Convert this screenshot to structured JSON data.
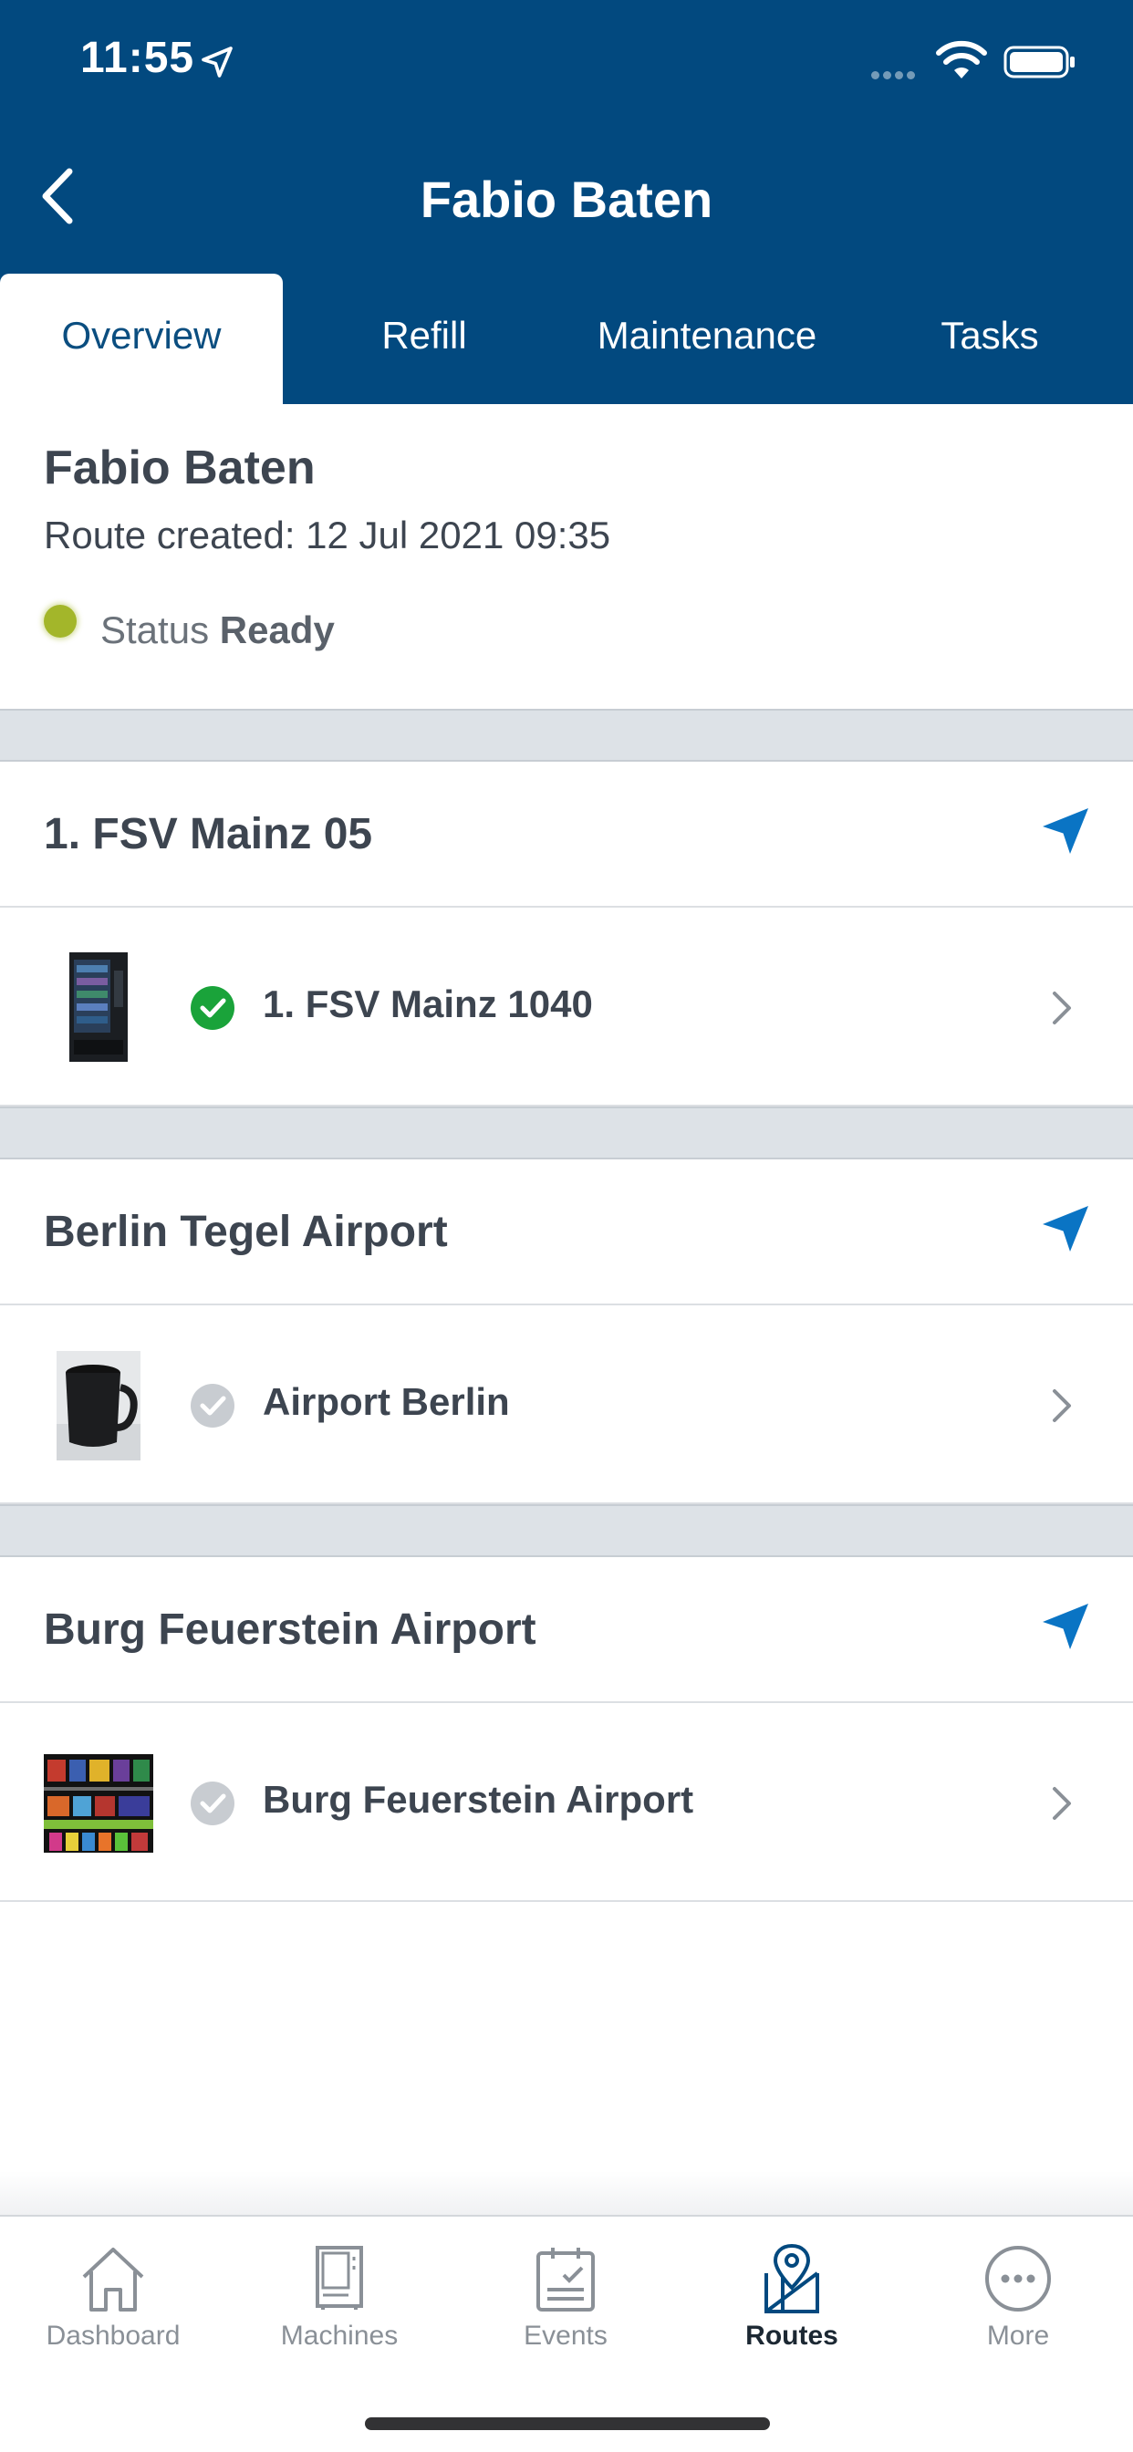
{
  "status_bar": {
    "time": "11:55"
  },
  "nav": {
    "title": "Fabio Baten"
  },
  "tabs": [
    {
      "label": "Overview",
      "active": true
    },
    {
      "label": "Refill",
      "active": false
    },
    {
      "label": "Maintenance",
      "active": false
    },
    {
      "label": "Tasks",
      "active": false
    }
  ],
  "overview": {
    "name": "Fabio Baten",
    "created": "Route created: 12 Jul 2021 09:35",
    "status_label": "Status",
    "status_value": "Ready",
    "status_color": "#a3b62a"
  },
  "locations": [
    {
      "name": "1. FSV Mainz 05",
      "machine": {
        "name": "1. FSV Mainz 1040",
        "done": true,
        "thumbnail": "vending-machine-image"
      }
    },
    {
      "name": "Berlin Tegel Airport",
      "machine": {
        "name": "Airport Berlin",
        "done": false,
        "thumbnail": "mug-image"
      }
    },
    {
      "name": "Burg Feuerstein Airport",
      "machine": {
        "name": "Burg Feuerstein Airport",
        "done": false,
        "thumbnail": "snack-shelf-image"
      }
    }
  ],
  "bottom_nav": [
    {
      "label": "Dashboard",
      "icon": "home-icon",
      "active": false
    },
    {
      "label": "Machines",
      "icon": "machine-icon",
      "active": false
    },
    {
      "label": "Events",
      "icon": "clipboard-icon",
      "active": false
    },
    {
      "label": "Routes",
      "icon": "map-pin-icon",
      "active": true
    },
    {
      "label": "More",
      "icon": "more-icon",
      "active": false
    }
  ],
  "colors": {
    "primary": "#02497f",
    "accent": "#0a74c4",
    "success": "#1aa33a",
    "inactive": "#c8ccd1"
  }
}
